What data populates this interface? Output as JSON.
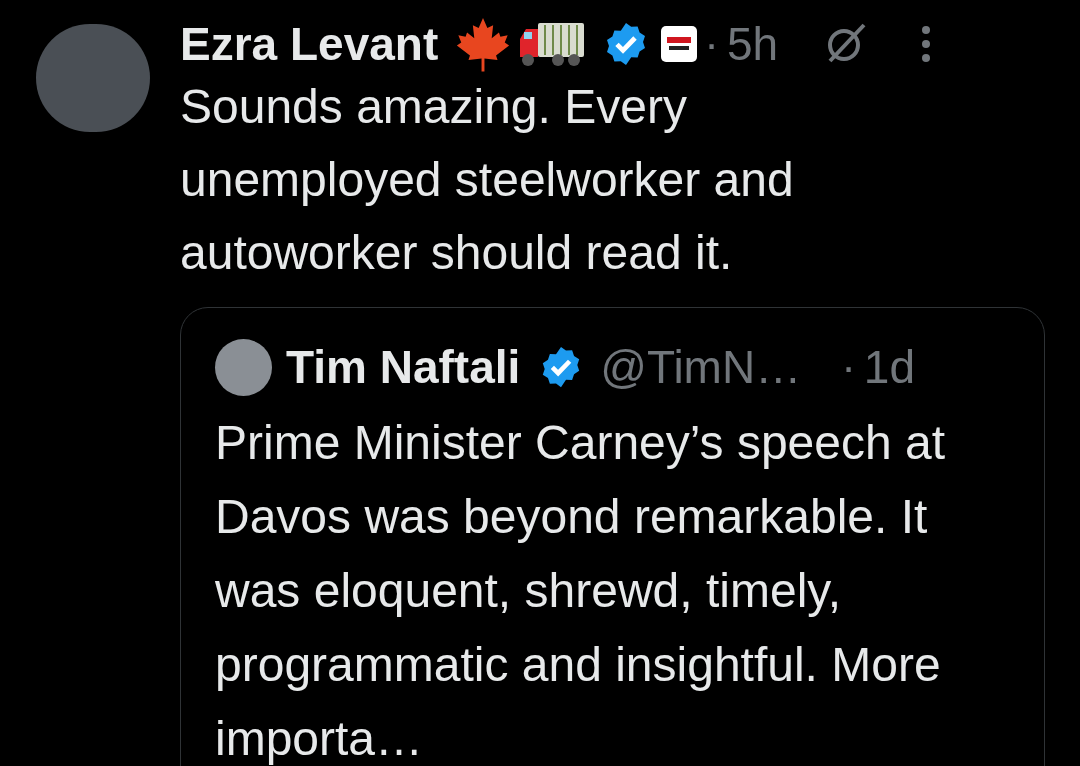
{
  "post": {
    "author": {
      "name": "Ezra Levant",
      "verified": true
    },
    "separator": "·",
    "time": "5h",
    "text": "Sounds amazing. Every unemployed steelworker and autoworker should read it.",
    "quoted_post": {
      "author": {
        "name": "Tim Naftali",
        "verified": true,
        "handle": "@TimN…"
      },
      "separator": "·",
      "time": "1d",
      "text": "Prime Minister Carney’s speech at Davos was beyond remarkable. It was eloquent, shrewd, timely, programmatic and insightful. More importa…"
    }
  }
}
